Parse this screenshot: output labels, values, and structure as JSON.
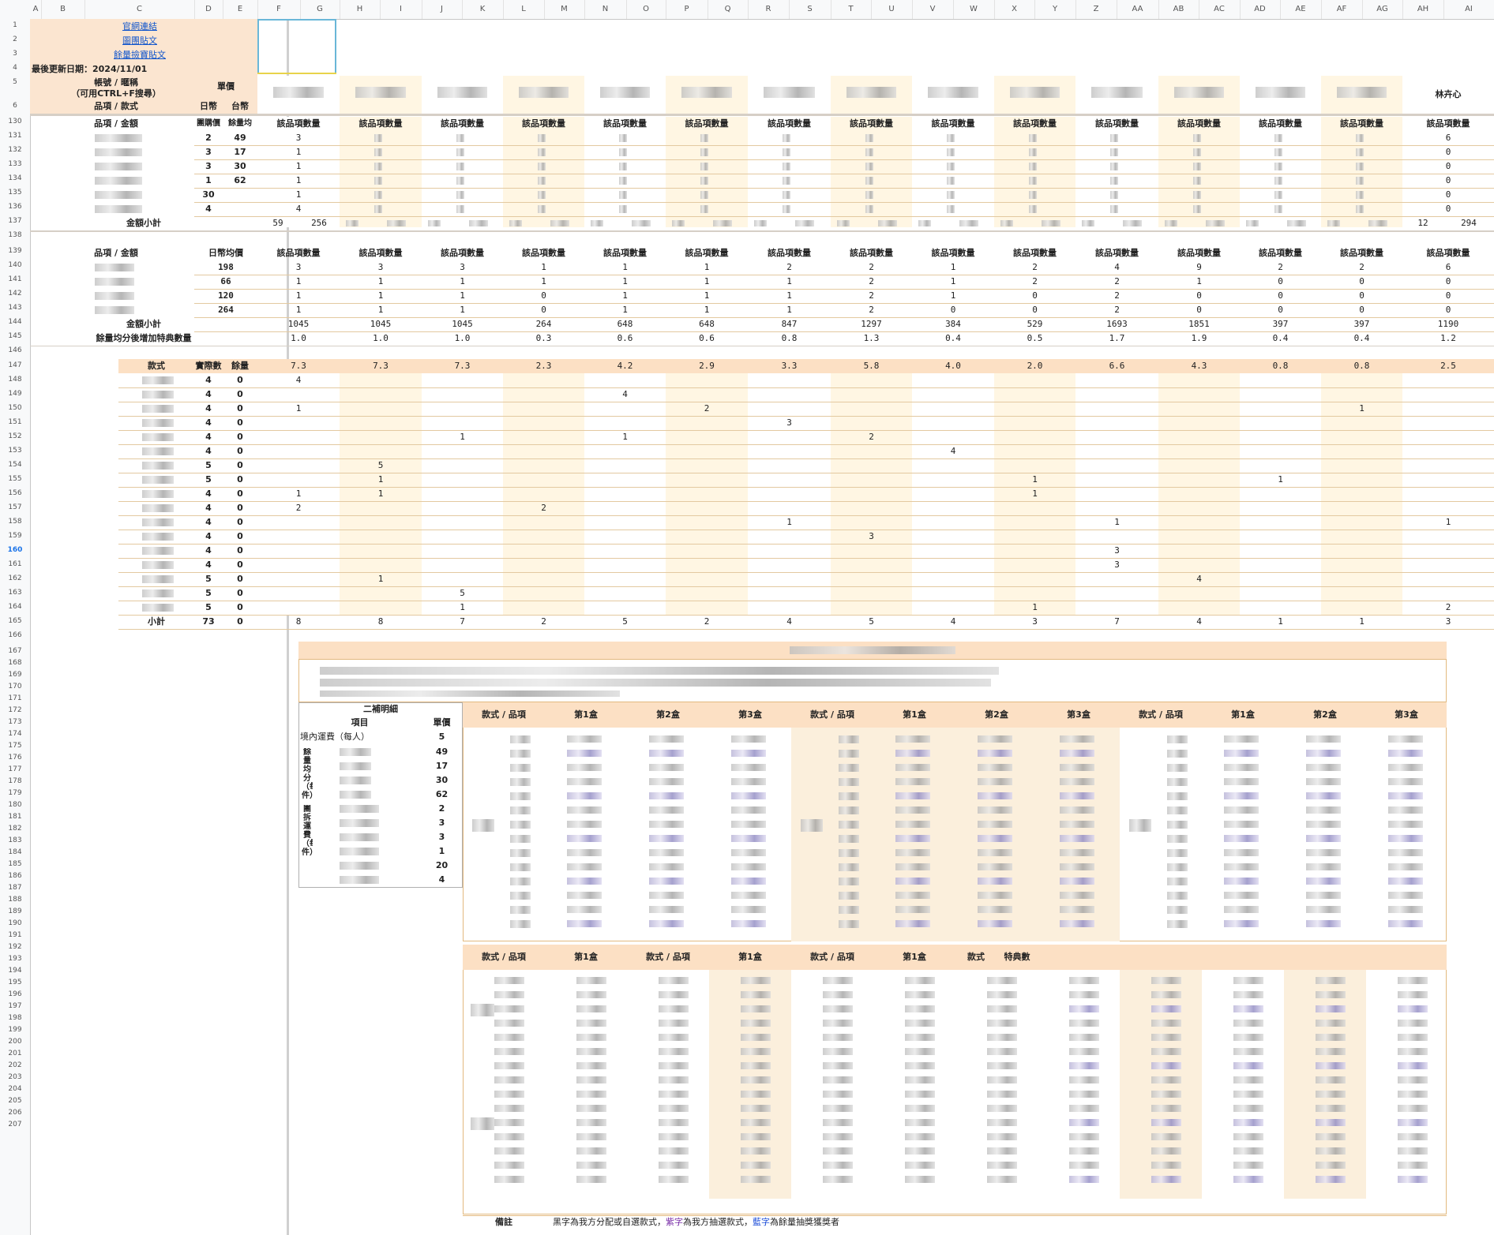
{
  "column_letters": [
    "A",
    "B",
    "C",
    "D",
    "E",
    "F",
    "G",
    "H",
    "I",
    "J",
    "K",
    "L",
    "M",
    "N",
    "O",
    "P",
    "Q",
    "R",
    "S",
    "T",
    "U",
    "V",
    "W",
    "X",
    "Y",
    "Z",
    "AA",
    "AB",
    "AC",
    "AD",
    "AE",
    "AF",
    "AG",
    "AH",
    "AI"
  ],
  "row_numbers": [
    "1",
    "2",
    "3",
    "4",
    "5",
    "6",
    "130",
    "131",
    "132",
    "133",
    "134",
    "135",
    "136",
    "137",
    "138",
    "139",
    "140",
    "141",
    "142",
    "143",
    "144",
    "145",
    "146",
    "147",
    "148",
    "149",
    "150",
    "151",
    "152",
    "153",
    "154",
    "155",
    "156",
    "157",
    "158",
    "159",
    "160",
    "161",
    "162",
    "163",
    "164",
    "165",
    "166",
    "167",
    "168",
    "169",
    "170",
    "171",
    "172",
    "173",
    "174",
    "175",
    "176",
    "177",
    "178",
    "179",
    "180",
    "181",
    "182",
    "183",
    "184",
    "185",
    "186",
    "187",
    "188",
    "189",
    "190",
    "191",
    "192",
    "193",
    "194",
    "195",
    "196",
    "197",
    "198",
    "199",
    "200",
    "201",
    "202",
    "203",
    "204",
    "205",
    "206",
    "207"
  ],
  "selected_row": "160",
  "links": [
    "官網連結",
    "圖團貼文",
    "餘量撿寶貼文"
  ],
  "last_update": "最後更新日期：2024/11/01",
  "header": {
    "account": "帳號 / 暱稱",
    "search_hint": "（可用CTRL+F搜尋）",
    "unit_price": "單價",
    "item_style": "品項 / 款式",
    "daily": "日幣",
    "twd": "台幣",
    "last_name": "林卉心"
  },
  "sec1": {
    "head_left": "品項 / 金額",
    "head_d": "團購價",
    "head_e": "餘量均",
    "col_label": "該品項數量",
    "rows": [
      {
        "d": "2",
        "e": "49",
        "f": "3",
        "ah": "6"
      },
      {
        "d": "3",
        "e": "17",
        "f": "1",
        "ah": "0"
      },
      {
        "d": "3",
        "e": "30",
        "f": "1",
        "ah": "0"
      },
      {
        "d": "1",
        "e": "62",
        "f": "1",
        "ah": "0"
      },
      {
        "d": "30",
        "e": "",
        "f": "1",
        "ah": "0"
      },
      {
        "d": "4",
        "e": "",
        "f": "4",
        "ah": "0"
      }
    ],
    "subtotal_label": "金額小計",
    "subtotal_f": "59",
    "subtotal_g": "256",
    "subtotal_ah": "12",
    "subtotal_ai": "294"
  },
  "sec2": {
    "head_left": "品項 / 金額",
    "head_d": "日幣均價",
    "col_label": "該品項數量",
    "prices": [
      "198",
      "66",
      "120",
      "264"
    ],
    "cols": [
      [
        "3",
        "1",
        "1",
        "1"
      ],
      [
        "3",
        "1",
        "1",
        "1"
      ],
      [
        "3",
        "1",
        "1",
        "1"
      ],
      [
        "1",
        "1",
        "0",
        "0"
      ],
      [
        "1",
        "1",
        "1",
        "1"
      ],
      [
        "1",
        "1",
        "1",
        "1"
      ],
      [
        "2",
        "1",
        "1",
        "1"
      ],
      [
        "2",
        "2",
        "2",
        "2"
      ],
      [
        "1",
        "1",
        "1",
        "0"
      ],
      [
        "2",
        "2",
        "0",
        "0"
      ],
      [
        "4",
        "2",
        "2",
        "2"
      ],
      [
        "9",
        "1",
        "0",
        "0"
      ],
      [
        "2",
        "0",
        "0",
        "0"
      ],
      [
        "2",
        "0",
        "0",
        "0"
      ],
      [
        "6",
        "0",
        "0",
        "0"
      ]
    ],
    "subtotal_label": "金額小計",
    "subtotals": [
      "1045",
      "1045",
      "1045",
      "264",
      "648",
      "648",
      "847",
      "1297",
      "384",
      "529",
      "1693",
      "1851",
      "397",
      "397",
      "1190"
    ],
    "bonus_label": "餘量均分後增加特典數量",
    "bonus": [
      "1.0",
      "1.0",
      "1.0",
      "0.3",
      "0.6",
      "0.6",
      "0.8",
      "1.3",
      "0.4",
      "0.5",
      "1.7",
      "1.9",
      "0.4",
      "0.4",
      "1.2"
    ]
  },
  "sec3": {
    "head_c": "款式",
    "head_d": "實際數",
    "head_e": "餘量",
    "band": [
      "7.3",
      "7.3",
      "7.3",
      "2.3",
      "4.2",
      "2.9",
      "3.3",
      "5.8",
      "4.0",
      "2.0",
      "6.6",
      "4.3",
      "0.8",
      "0.8",
      "2.5"
    ],
    "rows": [
      {
        "d": "4",
        "e": "0",
        "v": {
          "0": "4"
        }
      },
      {
        "d": "4",
        "e": "0",
        "v": {
          "4": "4"
        }
      },
      {
        "d": "4",
        "e": "0",
        "v": {
          "0": "1",
          "5": "2",
          "13": "1"
        }
      },
      {
        "d": "4",
        "e": "0",
        "v": {
          "6": "3"
        }
      },
      {
        "d": "4",
        "e": "0",
        "v": {
          "2": "1",
          "4": "1",
          "7": "2"
        }
      },
      {
        "d": "4",
        "e": "0",
        "v": {
          "8": "4"
        }
      },
      {
        "d": "5",
        "e": "0",
        "v": {
          "1": "5"
        }
      },
      {
        "d": "5",
        "e": "0",
        "v": {
          "1": "1",
          "9": "1",
          "12": "1"
        }
      },
      {
        "d": "4",
        "e": "0",
        "v": {
          "0": "1",
          "1": "1",
          "9": "1"
        }
      },
      {
        "d": "4",
        "e": "0",
        "v": {
          "0": "2",
          "3": "2"
        }
      },
      {
        "d": "4",
        "e": "0",
        "v": {
          "6": "1",
          "10": "1",
          "14": "1"
        }
      },
      {
        "d": "4",
        "e": "0",
        "v": {
          "7": "3"
        }
      },
      {
        "d": "4",
        "e": "0",
        "v": {
          "10": "3"
        }
      },
      {
        "d": "4",
        "e": "0",
        "v": {
          "10": "3"
        }
      },
      {
        "d": "5",
        "e": "0",
        "v": {
          "1": "1",
          "11": "4"
        }
      },
      {
        "d": "5",
        "e": "0",
        "v": {
          "2": "5"
        }
      },
      {
        "d": "5",
        "e": "0",
        "v": {
          "2": "1",
          "9": "1",
          "14": "2"
        }
      }
    ],
    "subtotal_label": "小計",
    "subtotal_d": "73",
    "subtotal_e": "0",
    "subtotals": [
      "8",
      "8",
      "7",
      "2",
      "5",
      "2",
      "4",
      "5",
      "4",
      "3",
      "7",
      "4",
      "1",
      "1",
      "3"
    ]
  },
  "detail": {
    "title": "二補明細",
    "item": "項目",
    "price": "單價",
    "shipping": "境內運費（每人）",
    "shipping_val": "5",
    "group1": "餘量均分（每件）",
    "group1_vals": [
      "49",
      "17",
      "30",
      "62"
    ],
    "group2": "團拆運費（每件）",
    "group2_vals": [
      "2",
      "3",
      "3",
      "1",
      "20",
      "4"
    ]
  },
  "box_table": {
    "style_item": "款式 / 品項",
    "box1": "第1盒",
    "box2": "第2盒",
    "box3": "第3盒",
    "style": "款式",
    "bonus_count": "特典數"
  },
  "remark_label": "備註",
  "remark": {
    "p1": "黑字為我方分配或自選款式，",
    "p2": "紫字",
    "p3": "為我方抽選款式，",
    "p4": "藍字",
    "p5": "為餘量抽獎獲獎者"
  },
  "colors": {
    "peach": "#fbe5d0",
    "cream": "#fff6e3",
    "band": "#fce0c4",
    "link": "#1155cc",
    "purple": "#7a2fa8",
    "blue": "#1f4fd8"
  }
}
